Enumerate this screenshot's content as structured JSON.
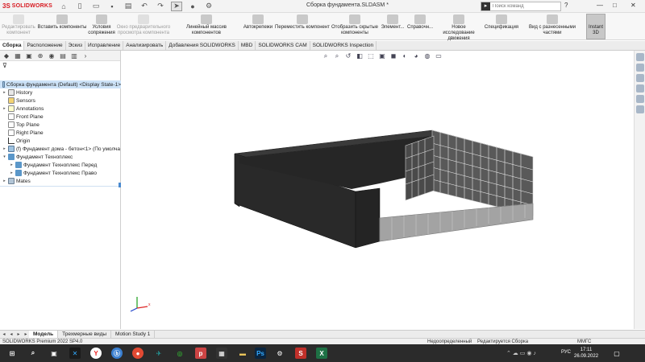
{
  "titlebar": {
    "logo_text": "SOLIDWORKS",
    "logo_mark": "3S",
    "document_title": "Сборка фундамента.SLDASM *",
    "search_placeholder": "Поиск команд",
    "minimize": "—",
    "maximize": "□",
    "close": "✕"
  },
  "ribbon": {
    "buttons": [
      {
        "label": "Редактировать\nкомпонент",
        "enabled": false
      },
      {
        "label": "Вставить компоненты",
        "enabled": true
      },
      {
        "label": "Условия\nсопряжения",
        "enabled": true
      },
      {
        "label": "Окно предварительного\nпросмотра компонента",
        "enabled": false
      },
      {
        "label": "Линейный массив компонентов",
        "enabled": true
      },
      {
        "label": "Автокрепежи",
        "enabled": true
      },
      {
        "label": "Переместить компонент",
        "enabled": true
      },
      {
        "label": "Отобразить скрытые\nкомпоненты",
        "enabled": true
      },
      {
        "label": "Элемент...",
        "enabled": true
      },
      {
        "label": "Справочн...",
        "enabled": true
      },
      {
        "label": "Новое исследование\nдвижения",
        "enabled": true
      },
      {
        "label": "Спецификация",
        "enabled": true
      },
      {
        "label": "Вид с разнесенными частями",
        "enabled": true
      }
    ],
    "instant3d": "Instant\n3D"
  },
  "tabs": [
    "Сборка",
    "Расположение",
    "Эскиз",
    "Исправление",
    "Анализировать",
    "Добавления SOLIDWORKS",
    "MBD",
    "SOLIDWORKS CAM",
    "SOLIDWORKS Inspection"
  ],
  "active_tab": "Сборка",
  "tree": {
    "root": "Сборка фундамента (Default) <Display State-1>",
    "items": [
      {
        "label": "History",
        "icon": "history-icon"
      },
      {
        "label": "Sensors",
        "icon": "sensor-icon"
      },
      {
        "label": "Annotations",
        "icon": "annotation-icon"
      },
      {
        "label": "Front Plane",
        "icon": "plane-icon"
      },
      {
        "label": "Top Plane",
        "icon": "plane-icon"
      },
      {
        "label": "Right Plane",
        "icon": "plane-icon"
      },
      {
        "label": "Origin",
        "icon": "origin-icon"
      },
      {
        "label": "(f) Фундамент дома - бетон<1> (По умолча",
        "icon": "part-icon"
      },
      {
        "label": "Фундамент Техноплекс",
        "icon": "folder-icon"
      },
      {
        "label": "Фундамент Техноплекс Перед",
        "icon": "folder-icon"
      },
      {
        "label": "Фундамент Техноплекс Право",
        "icon": "folder-icon"
      },
      {
        "label": "Mates",
        "icon": "mates-icon"
      }
    ]
  },
  "bottom_tabs": [
    "Модель",
    "Трехмерные виды",
    "Motion Study 1"
  ],
  "active_bottom_tab": "Модель",
  "status": {
    "product": "SOLIDWORKS Premium 2022 SP4.0",
    "definition": "Недоопределенный",
    "mode": "Редактируется Сборка",
    "units": "ММГС"
  },
  "taskbar": {
    "lang": "РУС",
    "time": "17:11",
    "date": "26.09.2022"
  },
  "colors": {
    "accent": "#d71920",
    "selection": "#cde3f8",
    "model_dark": "#2a2a2a",
    "mesh_grey": "#9a9a9a"
  }
}
